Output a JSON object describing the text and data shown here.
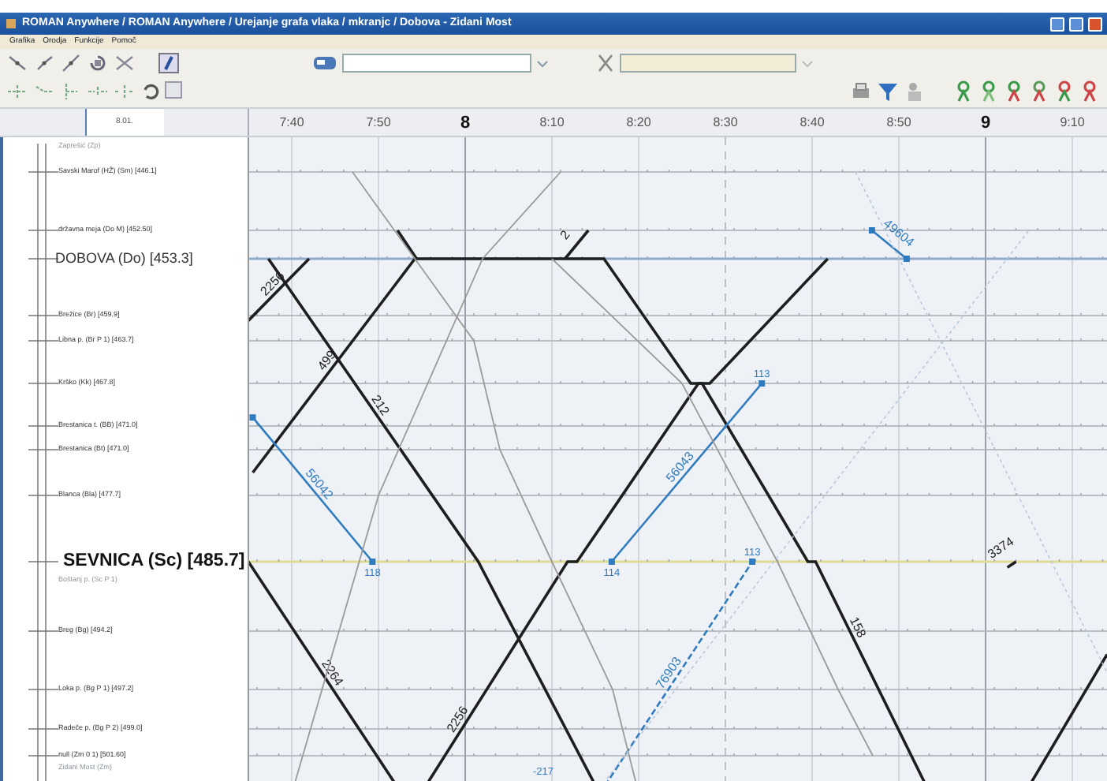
{
  "window": {
    "title": "ROMAN Anywhere / ROMAN Anywhere / Urejanje grafa vlaka / mkranjc / Dobova - Zidani Most"
  },
  "menu": [
    "Grafika",
    "Orodja",
    "Funkcije",
    "Pomoč"
  ],
  "header_field": "8.01.",
  "time_header": [
    {
      "label": "7:40",
      "major": false
    },
    {
      "label": "7:50",
      "major": false
    },
    {
      "label": "8",
      "major": true
    },
    {
      "label": "8:10",
      "major": false
    },
    {
      "label": "8:20",
      "major": false
    },
    {
      "label": "8:30",
      "major": false
    },
    {
      "label": "8:40",
      "major": false
    },
    {
      "label": "8:50",
      "major": false
    },
    {
      "label": "9",
      "major": true
    },
    {
      "label": "9:10",
      "major": false
    }
  ],
  "stations": [
    {
      "name": "Zaprešić (Zp)",
      "kind": "faded"
    },
    {
      "name": "Savski Marof (HŽ) (Sm) [446.1]",
      "kind": "normal"
    },
    {
      "name": "državna meja (Do M) [452.50]",
      "kind": "normal"
    },
    {
      "name": "DOBOVA (Do) [453.3]",
      "kind": "large",
      "color": "#8fa9c9"
    },
    {
      "name": "Brežice (Br) [459.9]",
      "kind": "normal"
    },
    {
      "name": "Libna p. (Br P 1) [463.7]",
      "kind": "normal"
    },
    {
      "name": "Krško (Kk) [467.8]",
      "kind": "normal"
    },
    {
      "name": "Brestanica t. (BB) [471.0]",
      "kind": "normal"
    },
    {
      "name": "Brestanica (Bt) [471.0]",
      "kind": "normal"
    },
    {
      "name": "Blanca (Bla) [477.7]",
      "kind": "normal"
    },
    {
      "name": "SEVNICA (Sc) [485.7]",
      "kind": "huge",
      "color": "#dcdc96"
    },
    {
      "name": "Boštanj p. (Sc P 1)",
      "kind": "faded"
    },
    {
      "name": "Breg (Bg) [494.2]",
      "kind": "normal"
    },
    {
      "name": "Loka p. (Bg P 1) [497.2]",
      "kind": "normal"
    },
    {
      "name": "Radeče p. (Bg P 2) [499.0]",
      "kind": "normal"
    },
    {
      "name": "null (Zm 0 1) [501.60]",
      "kind": "normal"
    },
    {
      "name": "Zidani Most (Zm)",
      "kind": "faded"
    }
  ],
  "trains": [
    {
      "number": "212",
      "kind": "thick"
    },
    {
      "number": "2256",
      "kind": "thick"
    },
    {
      "number": "499",
      "kind": "thick"
    },
    {
      "number": "158",
      "kind": "thick"
    },
    {
      "number": "2",
      "kind": "thick"
    },
    {
      "number": "2256",
      "kind": "thick"
    },
    {
      "number": "2264",
      "kind": "thick"
    },
    {
      "number": "3374",
      "kind": "thick"
    },
    {
      "kind": "thick"
    },
    {
      "number": "56042",
      "kind": "blue"
    },
    {
      "number": "56043",
      "kind": "blue"
    },
    {
      "number": "49604",
      "kind": "blue"
    },
    {
      "number": "76903",
      "kind": "blue-dashed"
    },
    {
      "kind": "grey"
    },
    {
      "kind": "grey"
    },
    {
      "kind": "grey"
    },
    {
      "kind": "faint"
    },
    {
      "kind": "faint"
    }
  ],
  "stop_labels": [
    "118",
    "114",
    "113",
    "113",
    "-217"
  ]
}
